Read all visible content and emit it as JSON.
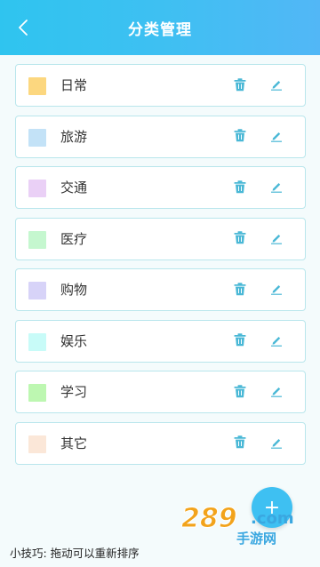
{
  "header": {
    "title": "分类管理",
    "back_icon": "chevron-left-icon"
  },
  "categories": [
    {
      "label": "日常",
      "color": "#fcd77f"
    },
    {
      "label": "旅游",
      "color": "#c3e2f7"
    },
    {
      "label": "交通",
      "color": "#ead0f6"
    },
    {
      "label": "医疗",
      "color": "#c5f7cf"
    },
    {
      "label": "购物",
      "color": "#d7d3f8"
    },
    {
      "label": "娱乐",
      "color": "#c8fbf8"
    },
    {
      "label": "学习",
      "color": "#bdf7b1"
    },
    {
      "label": "其它",
      "color": "#fbe7d8"
    }
  ],
  "item_actions": {
    "delete_icon": "trash-icon",
    "edit_icon": "pencil-icon"
  },
  "colors": {
    "accent": "#3ec0f2",
    "header_gradient_start": "#2fc4ef",
    "header_gradient_end": "#52b7f6",
    "card_border": "#b9e6ec",
    "icon_color": "#4ab8d6"
  },
  "fab": {
    "icon": "plus-icon"
  },
  "watermark": {
    "text": "289.com",
    "subtext": "手游网"
  },
  "footer": {
    "tip": "小技巧: 拖动可以重新排序"
  }
}
